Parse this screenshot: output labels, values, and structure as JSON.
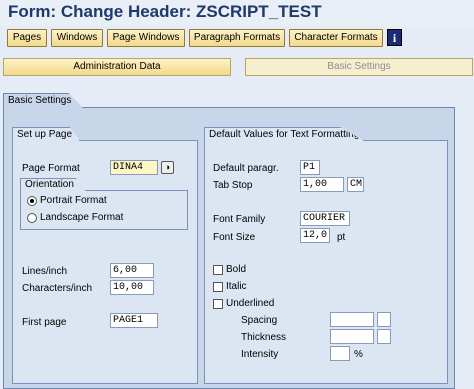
{
  "window": {
    "title": "Form: Change Header: ZSCRIPT_TEST"
  },
  "toolbar": {
    "buttons": [
      "Pages",
      "Windows",
      "Page Windows",
      "Paragraph Formats",
      "Character Formats"
    ],
    "info_icon": "info-icon"
  },
  "tabs": {
    "admin": "Administration Data",
    "basic": "Basic Settings"
  },
  "basic_settings": {
    "label": "Basic Settings"
  },
  "setup_page": {
    "label": "Set up Page",
    "page_format_label": "Page Format",
    "page_format_value": "DINA4",
    "orientation_label": "Orientation",
    "portrait_label": "Portrait Format",
    "landscape_label": "Landscape Format",
    "selected_orientation": "Portrait Format",
    "lines_label": "Lines/inch",
    "lines_value": "6,00",
    "chars_label": "Characters/inch",
    "chars_value": "10,00",
    "first_page_label": "First page",
    "first_page_value": "PAGE1"
  },
  "text_formatting": {
    "label": "Default Values for Text Formatting",
    "default_paragr_label": "Default paragr.",
    "default_paragr_value": "P1",
    "tab_stop_label": "Tab Stop",
    "tab_stop_value": "1,00",
    "tab_stop_unit": "CM",
    "font_family_label": "Font Family",
    "font_family_value": "COURIER",
    "font_size_label": "Font Size",
    "font_size_value": "12,0",
    "font_size_unit": "pt",
    "bold_label": "Bold",
    "italic_label": "Italic",
    "underlined_label": "Underlined",
    "spacing_label": "Spacing",
    "thickness_label": "Thickness",
    "intensity_label": "Intensity",
    "intensity_unit": "%"
  }
}
